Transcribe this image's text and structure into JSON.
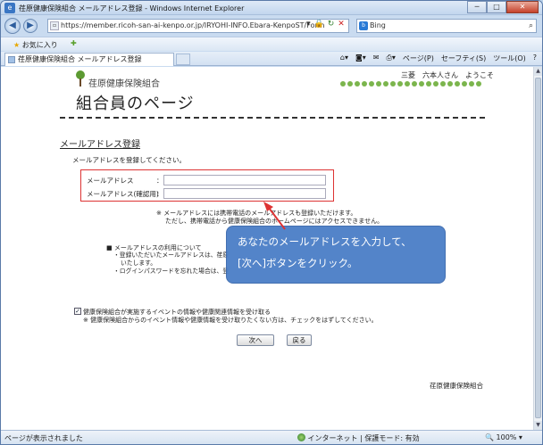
{
  "window": {
    "title": "荏原健康保険組合 メールアドレス登録 - Windows Internet Explorer",
    "buttons": {
      "minimize": "─",
      "maximize": "□",
      "close": "✕"
    }
  },
  "address_bar": {
    "url": "https://member.ricoh-san-ai-kenpo.or.jp/IRYOHI-INFO.Ebara-KenpoST/Form",
    "search_engine": "Bing",
    "search_placeholder": "Bing"
  },
  "favorites_bar": {
    "favorites_label": "お気に入り"
  },
  "tab": {
    "title": "荏原健康保険組合 メールアドレス登録"
  },
  "command_bar": {
    "page": "ページ(P)",
    "safety": "セーフティ(S)",
    "tools": "ツール(O)",
    "help": "?"
  },
  "page": {
    "org_name": "荏原健康保険組合",
    "title": "組合員のページ",
    "user_greeting": "三菱　六本人さん　ようこそ",
    "section_title": "メールアドレス登録",
    "intro": "メールアドレスを登録してください。",
    "form": {
      "email_label": "メールアドレス",
      "email_confirm_label": "メールアドレス(確認用)",
      "colon": "：",
      "email_value": "",
      "email_confirm_value": ""
    },
    "note_line1": "※ メールアドレスには携帯電話のメールアドレスも登録いただけます。",
    "note_line2": "ただし、携帯電話から健康保険組合のホームページにはアクセスできません。",
    "terms_title": "■ メールアドレスの利用について",
    "terms_line1": "・登録いただいたメールアドレスは、荏原",
    "terms_line2": "いたします。",
    "terms_line3": "・ログインパスワードを忘れた場合は、登",
    "checkbox_label": "健康保険組合が実施するイベントの情報や健康関連情報を受け取る",
    "checkbox_checked": true,
    "checkbox_note": "※ 健康保険組合からのイベント情報や健康情報を受け取りたくない方は、チェックをはずしてください。",
    "next_button": "次へ",
    "back_button": "戻る",
    "footer_org": "荏原健康保険組合"
  },
  "callout": {
    "line1": "あなたのメールアドレスを入力して、",
    "line2": "[次へ]ボタンをクリック。",
    "color": "#4a7ec7"
  },
  "status_bar": {
    "left": "ページが表示されました",
    "zone": "インターネット | 保護モード: 有効",
    "zoom": "100%"
  }
}
